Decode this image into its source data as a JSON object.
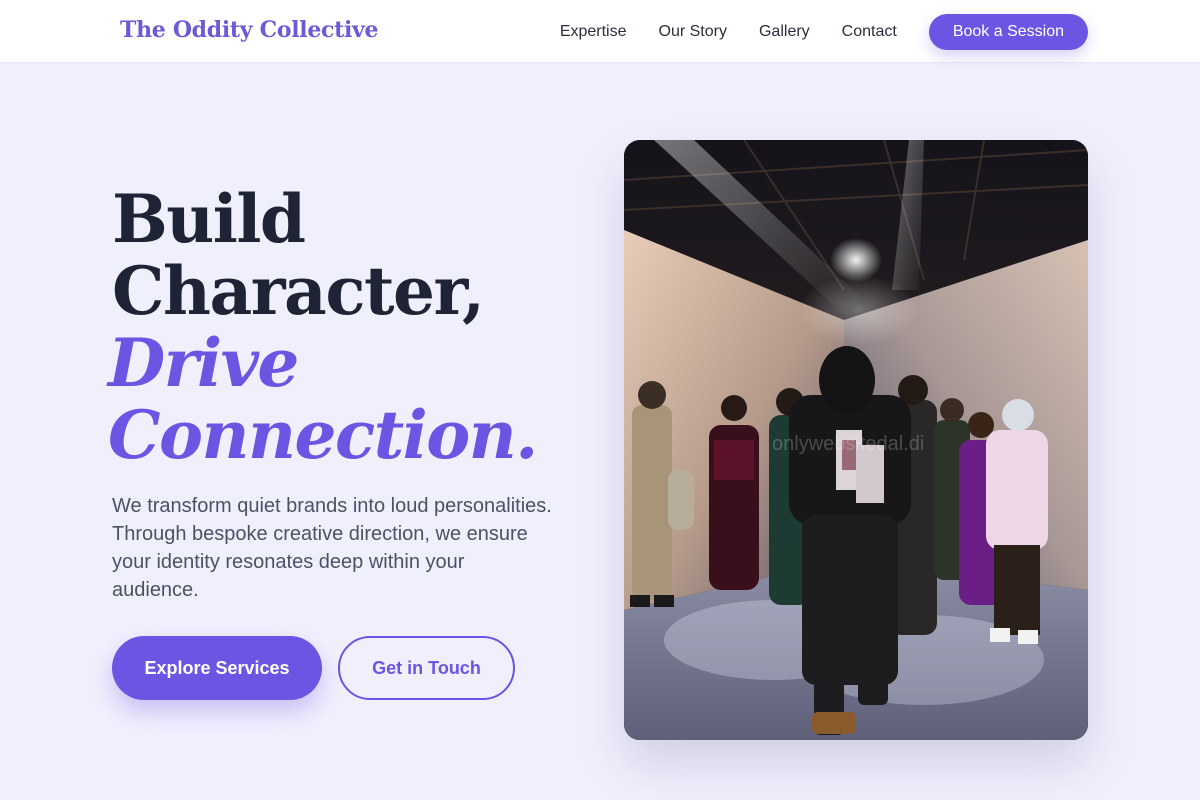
{
  "brand": {
    "name": "The Oddity Collective"
  },
  "nav": {
    "links": [
      "Expertise",
      "Our Story",
      "Gallery",
      "Contact"
    ],
    "cta_label": "Book a Session"
  },
  "hero": {
    "title_line1": "Build",
    "title_line2": "Character,",
    "title_line3": "Drive",
    "title_line4": "Connection.",
    "description": "We transform quiet brands into loud personalities. Through bespoke creative direction, we ensure your identity resonates deep within your audience.",
    "primary_button": "Explore Services",
    "secondary_button": "Get in Touch",
    "image_watermark": "onlywebsitedal.di"
  },
  "colors": {
    "accent": "#6a56e2",
    "brand": "#6a5bd6",
    "background": "#f0f0fd",
    "heading": "#1e2435",
    "body_text": "#4b5263"
  }
}
